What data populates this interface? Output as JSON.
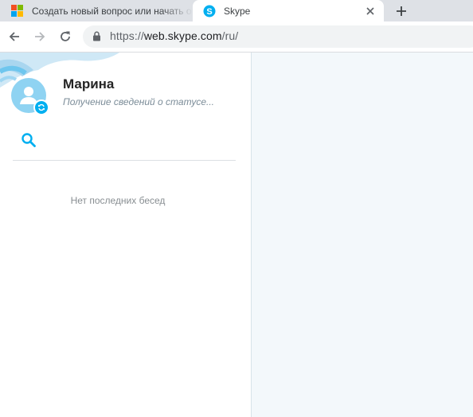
{
  "browser": {
    "tabs": [
      {
        "title": "Создать новый вопрос или начать обсуждение",
        "favicon": "microsoft-logo-icon",
        "active": false
      },
      {
        "title": "Skype",
        "favicon": "skype-icon",
        "active": true
      }
    ],
    "new_tab_icon": "plus-icon",
    "url": {
      "scheme": "https://",
      "host": "web.skype.com",
      "path": "/ru/"
    },
    "controls": [
      "back-arrow-icon",
      "forward-arrow-icon",
      "reload-icon",
      "lock-icon"
    ]
  },
  "skype": {
    "profile": {
      "name": "Марина",
      "status": "Получение сведений о статусе..."
    },
    "recent": {
      "empty_text": "Нет последних бесед"
    },
    "accent_color": "#00aff0",
    "content_background": "#f3f8fb"
  }
}
